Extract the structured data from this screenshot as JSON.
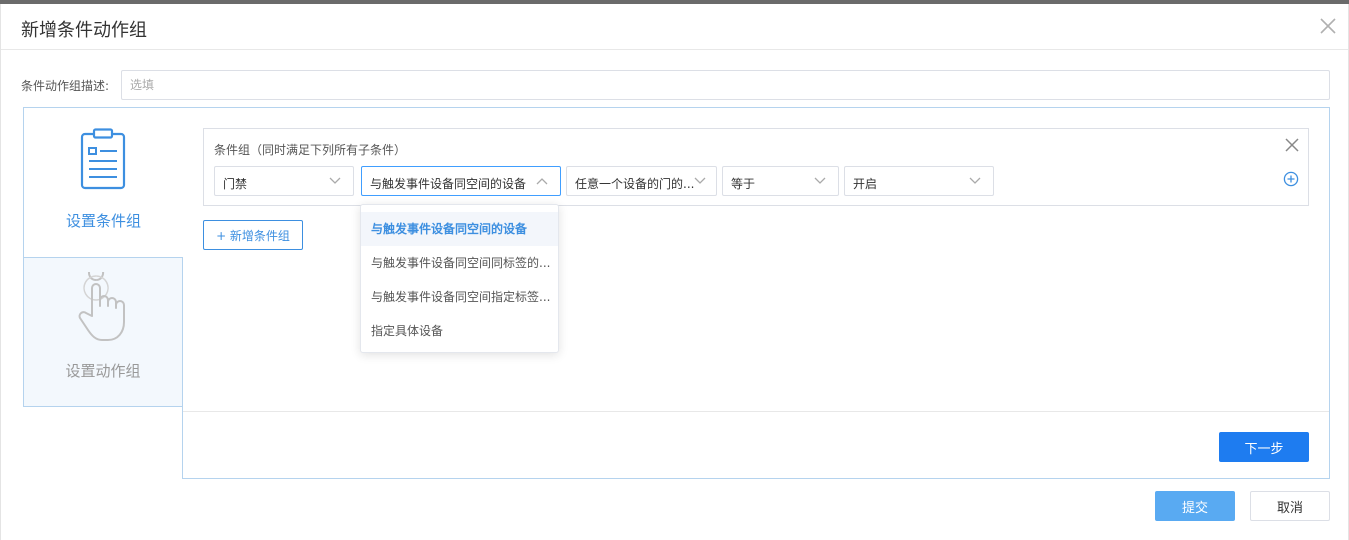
{
  "dialog": {
    "title": "新增条件动作组",
    "close_icon": "close-icon"
  },
  "description": {
    "label": "条件动作组描述:",
    "value": "",
    "placeholder": "选填"
  },
  "steps": [
    {
      "label": "设置条件组",
      "icon": "clipboard-icon",
      "active": true
    },
    {
      "label": "设置动作组",
      "icon": "hand-pointer-icon",
      "active": false
    }
  ],
  "condition_group": {
    "title": "条件组（同时满足下列所有子条件）",
    "selects": [
      {
        "value": "门禁"
      },
      {
        "value": "与触发事件设备同空间的设备",
        "open": true
      },
      {
        "value": "任意一个设备的门的..."
      },
      {
        "value": "等于"
      },
      {
        "value": "开启"
      }
    ],
    "close_icon": "close-icon",
    "add_icon": "plus-circle-icon"
  },
  "dropdown": {
    "options": [
      {
        "label": "与触发事件设备同空间的设备",
        "selected": true
      },
      {
        "label": "与触发事件设备同空间同标签的..."
      },
      {
        "label": "与触发事件设备同空间指定标签..."
      },
      {
        "label": "指定具体设备"
      }
    ]
  },
  "buttons": {
    "add_condition_group": "+ 新增条件组",
    "next": "下一步",
    "submit": "提交",
    "cancel": "取消"
  },
  "colors": {
    "accent": "#3d8fe0",
    "primary_button": "#1e7cf0",
    "submit_button": "#59aaf2",
    "frame_border": "#b5d3ee"
  }
}
